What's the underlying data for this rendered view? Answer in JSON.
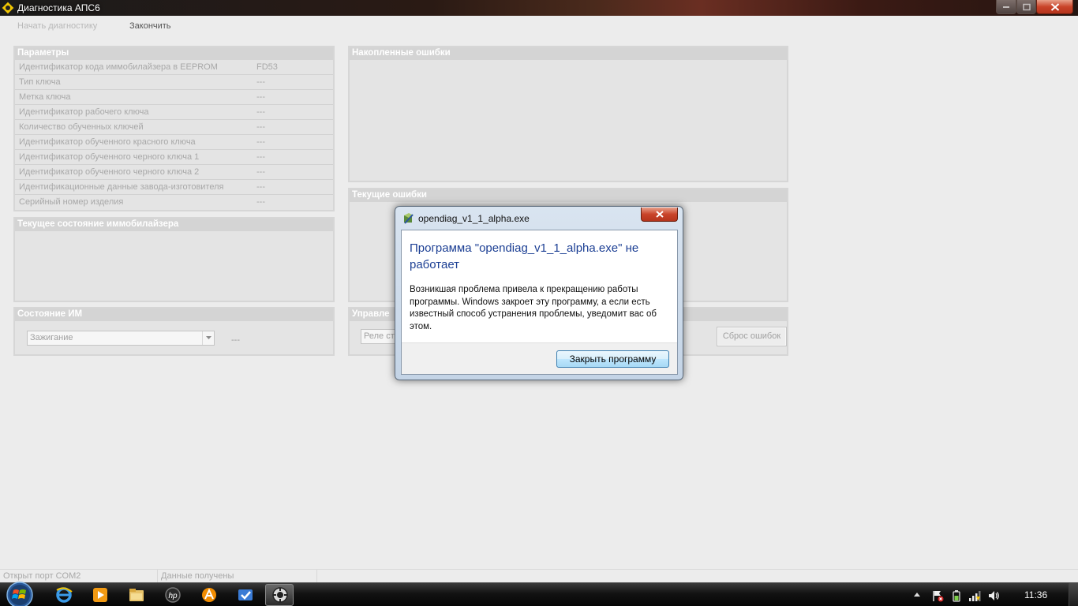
{
  "window": {
    "title": "Диагностика АПС6"
  },
  "menu": {
    "start_label": "Начать диагностику",
    "end_label": "Закончить"
  },
  "params_panel": {
    "header": "Параметры",
    "rows": [
      {
        "label": "Идентификатор кода иммобилайзера в EEPROM",
        "value": "FD53"
      },
      {
        "label": "Тип ключа",
        "value": "---"
      },
      {
        "label": "Метка ключа",
        "value": "---"
      },
      {
        "label": "Идентификатор рабочего ключа",
        "value": "---"
      },
      {
        "label": "Количество обученных ключей",
        "value": "---"
      },
      {
        "label": "Идентификатор обученного красного ключа",
        "value": "---"
      },
      {
        "label": "Идентификатор обученного черного ключа 1",
        "value": "---"
      },
      {
        "label": "Идентификатор обученного черного ключа 2",
        "value": "---"
      },
      {
        "label": "Идентификационные данные завода-изготовителя",
        "value": "---"
      },
      {
        "label": "Серийный номер изделия",
        "value": "---"
      }
    ]
  },
  "immobilizer_panel": {
    "header": "Текущее состояние иммобилайзера"
  },
  "im_panel": {
    "header": "Состояние ИМ",
    "combo_value": "Зажигание",
    "value": "---"
  },
  "accumulated_errors": {
    "header": "Накопленные ошибки"
  },
  "current_errors": {
    "header": "Текущие ошибки"
  },
  "control_panel": {
    "header": "Управле",
    "combo_value": "Реле ст",
    "reset_label": "Сброс ошибок"
  },
  "dialog": {
    "title": "opendiag_v1_1_alpha.exe",
    "heading": "Программа \"opendiag_v1_1_alpha.exe\" не работает",
    "message": "Возникшая проблема привела к прекращению работы программы. Windows закроет эту программу, а если есть известный способ устранения проблемы, уведомит вас об этом.",
    "close_button": "Закрыть программу"
  },
  "statusbar": {
    "port": "Открыт порт COM2",
    "data": "Данные получены"
  },
  "taskbar": {
    "clock": "11:36",
    "apps": [
      "internet-explorer-icon",
      "media-player-icon",
      "file-explorer-icon",
      "hp-icon",
      "avast-icon",
      "mail-icon",
      "opendiag-icon"
    ]
  }
}
